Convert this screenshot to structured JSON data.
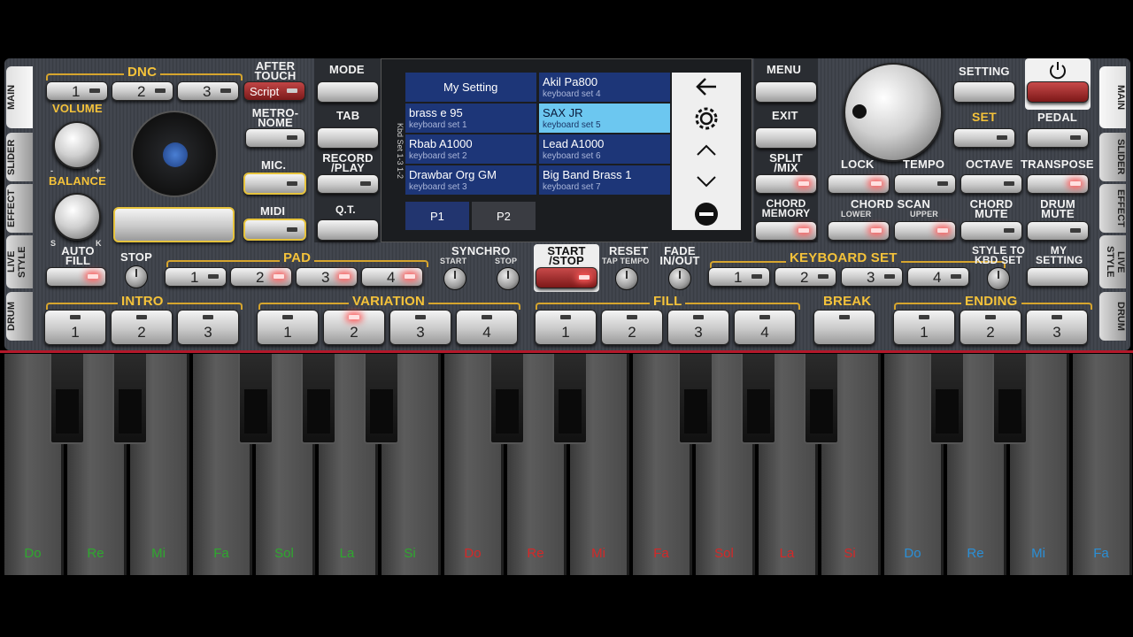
{
  "side_tabs_left": [
    "MAIN",
    "SLIDER",
    "EFFECT",
    "LIVE STYLE",
    "DRUM"
  ],
  "side_tabs_right": [
    "MAIN",
    "SLIDER",
    "EFFECT",
    "LIVE STYLE",
    "DRUM"
  ],
  "dnc": {
    "label": "DNC",
    "buttons": [
      "1",
      "2",
      "3"
    ],
    "script": "Script"
  },
  "after_touch": "AFTER TOUCH",
  "volume": "VOLUME",
  "balance": "BALANCE",
  "balance_marks": [
    "-",
    "+",
    "S",
    "K"
  ],
  "metronome": "METRO- NOME",
  "mic": "MIC.",
  "midi": "MIDI",
  "mode": "MODE",
  "tab": "TAB",
  "record_play": "RECORD /PLAY",
  "qt": "Q.T.",
  "menu": "MENU",
  "exit": "EXIT",
  "split_mix": "SPLIT /MIX",
  "chord_memory": "CHORD MEMORY",
  "setting": "SETTING",
  "set": "SET",
  "pedal": "PEDAL",
  "lock": "LOCK",
  "tempo": "TEMPO",
  "octave": "OCTAVE",
  "transpose": "TRANSPOSE",
  "chord_scan": {
    "label": "CHORD SCAN",
    "lower": "LOWER",
    "upper": "UPPER"
  },
  "chord_mute": "CHORD MUTE",
  "drum_mute": "DRUM MUTE",
  "auto_fill": "AUTO FILL",
  "stop": "STOP",
  "pad": {
    "label": "PAD",
    "buttons": [
      "1",
      "2",
      "3",
      "4"
    ]
  },
  "synchro": {
    "label": "SYNCHRO",
    "start": "START",
    "stop": "STOP"
  },
  "start_stop": "START /STOP",
  "reset": {
    "label": "RESET",
    "sub": "TAP TEMPO"
  },
  "fade": "FADE IN/OUT",
  "keyboard_set": {
    "label": "KEYBOARD SET",
    "buttons": [
      "1",
      "2",
      "3",
      "4"
    ]
  },
  "style_to_kbd": "STYLE TO KBD SET",
  "my_setting_btn": "MY SETTING",
  "intro": {
    "label": "INTRO",
    "buttons": [
      "1",
      "2",
      "3"
    ]
  },
  "variation": {
    "label": "VARIATION",
    "buttons": [
      "1",
      "2",
      "3",
      "4"
    ]
  },
  "fill": {
    "label": "FILL",
    "buttons": [
      "1",
      "2",
      "3",
      "4"
    ]
  },
  "break": "BREAK",
  "ending": {
    "label": "ENDING",
    "buttons": [
      "1",
      "2",
      "3"
    ]
  },
  "screen": {
    "side_label": "Kbd Set 1-3 1-2",
    "left_col": [
      {
        "title": "My Setting",
        "sub": ""
      },
      {
        "title": "brass e 95",
        "sub": "keyboard set 1"
      },
      {
        "title": "Rbab A1000",
        "sub": "keyboard set 2"
      },
      {
        "title": "Drawbar Org GM",
        "sub": "keyboard set 3"
      }
    ],
    "right_col": [
      {
        "title": "Akil Pa800",
        "sub": "keyboard set 4"
      },
      {
        "title": "SAX JR",
        "sub": "keyboard set 5"
      },
      {
        "title": "Lead A1000",
        "sub": "keyboard set 6"
      },
      {
        "title": "Big Band Brass 1",
        "sub": "keyboard set 7"
      }
    ],
    "pages": [
      "P1",
      "P2"
    ]
  },
  "notes": [
    "Do",
    "Re",
    "Mi",
    "Fa",
    "Sol",
    "La",
    "Si",
    "Do",
    "Re",
    "Mi",
    "Fa",
    "Sol",
    "La",
    "Si",
    "Do",
    "Re",
    "Mi",
    "Fa"
  ],
  "note_colors": [
    "#2ea82e",
    "#d42828",
    "#2a8fd6"
  ]
}
